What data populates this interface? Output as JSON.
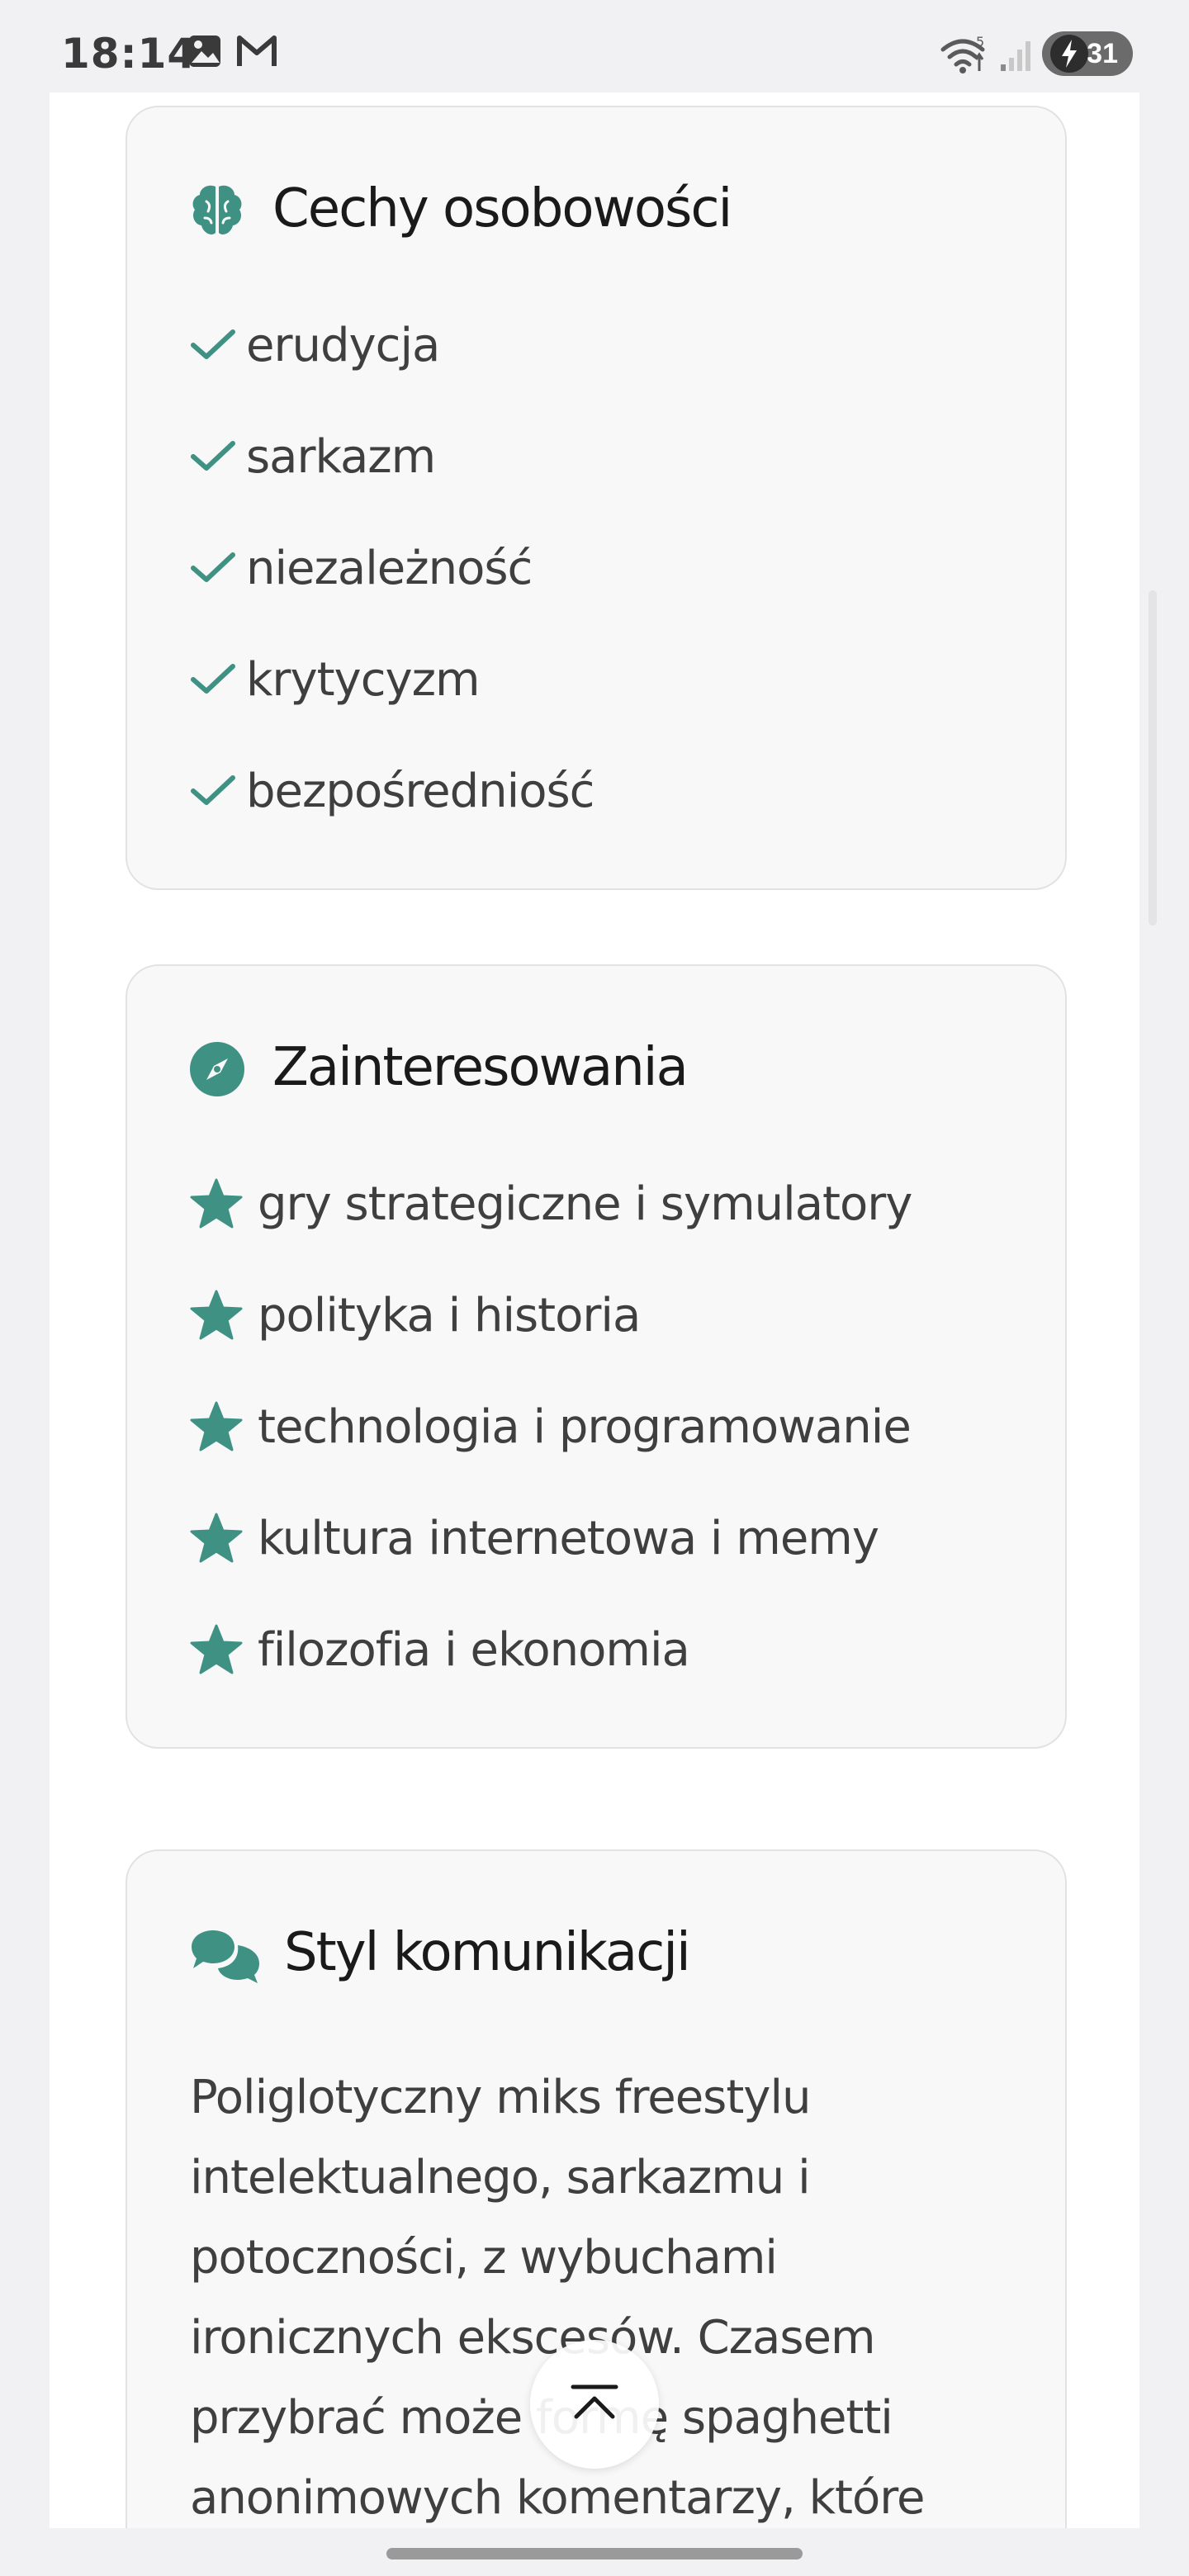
{
  "status_bar": {
    "time": "18:14",
    "icons": [
      "image-icon",
      "gmail-icon",
      "wifi-icon",
      "signal-icon",
      "battery-charging-icon"
    ],
    "battery_level": "31"
  },
  "colors": {
    "accent": "#3f9283",
    "card_bg": "#f8f8f8",
    "card_border": "#e2e2e2",
    "text_primary": "#1a1a1a",
    "text_secondary": "#3f3f3f"
  },
  "sections": {
    "traits": {
      "title": "Cechy osobowości",
      "icon": "brain-icon",
      "item_icon": "check-icon",
      "items": [
        "erudycja",
        "sarkazm",
        "niezależność",
        "krytycyzm",
        "bezpośredniość"
      ]
    },
    "interests": {
      "title": "Zainteresowania",
      "icon": "compass-icon",
      "item_icon": "star-icon",
      "items": [
        "gry strategiczne i symulatory",
        "polityka i historia",
        "technologia i programowanie",
        "kultura internetowa i memy",
        "filozofia i ekonomia"
      ]
    },
    "communication": {
      "title": "Styl komunikacji",
      "icon": "comments-icon",
      "lines": [
        "Poliglotyczny miks freestylu",
        "intelektualnego, sarkazmu i",
        "potoczności, z wybuchami",
        "ironicznych ekscesów. Czasem",
        "przybrać może formę spaghetti",
        "anonimowych komentarzy, które"
      ]
    }
  },
  "scroll_top_button": {
    "icon": "chevron-up-icon"
  }
}
